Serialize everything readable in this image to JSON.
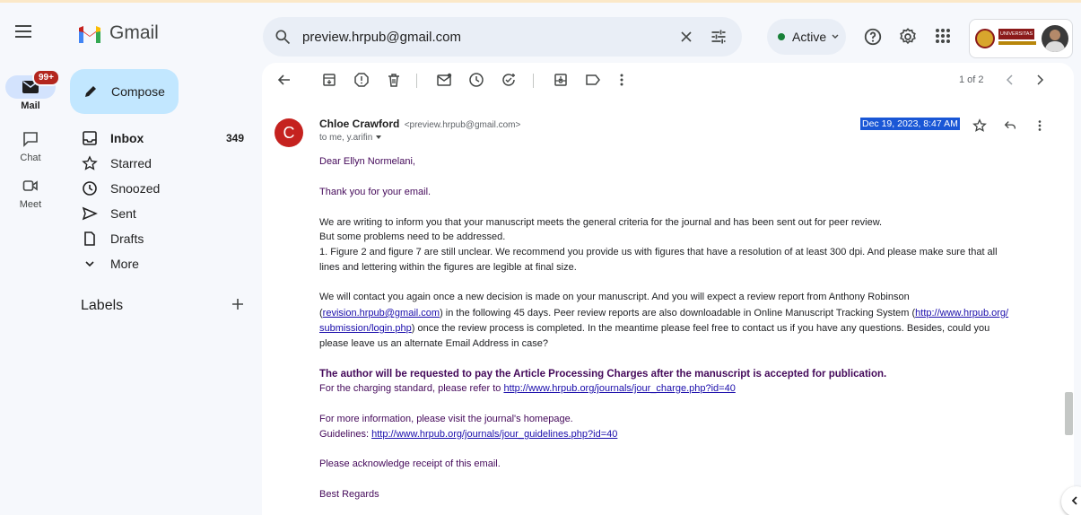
{
  "app": {
    "name": "Gmail"
  },
  "search": {
    "query": "preview.hrpub@gmail.com"
  },
  "status": {
    "label": "Active",
    "color": "#188038"
  },
  "rail": {
    "mail": {
      "label": "Mail",
      "badge": "99+"
    },
    "chat": {
      "label": "Chat"
    },
    "meet": {
      "label": "Meet"
    }
  },
  "nav": {
    "compose_label": "Compose",
    "items": [
      {
        "label": "Inbox",
        "count": "349",
        "icon": "inbox-icon"
      },
      {
        "label": "Starred",
        "count": "",
        "icon": "star-icon"
      },
      {
        "label": "Snoozed",
        "count": "",
        "icon": "clock-icon"
      },
      {
        "label": "Sent",
        "count": "",
        "icon": "send-icon"
      },
      {
        "label": "Drafts",
        "count": "",
        "icon": "draft-icon"
      },
      {
        "label": "More",
        "count": "",
        "icon": "chevron-down-icon"
      }
    ],
    "labels_heading": "Labels"
  },
  "toolbar": {
    "pager": "1 of 2",
    "icons": [
      "back-arrow-icon",
      "archive-icon",
      "report-spam-icon",
      "delete-icon",
      "mark-unread-icon",
      "snooze-icon",
      "add-task-icon",
      "move-to-icon",
      "label-icon",
      "more-vert-icon"
    ]
  },
  "message": {
    "sender_initial": "C",
    "sender_name": "Chloe Crawford",
    "sender_email": "<preview.hrpub@gmail.com>",
    "to_line": "to me, y.arifin",
    "date": "Dec 19, 2023, 8:47 AM",
    "avatar_color": "#c5221f",
    "body": {
      "greeting": "Dear Ellyn Normelani,",
      "thanks": "Thank you for your email.",
      "p1_line1": "We are writing to inform you that your manuscript meets the general criteria for the journal and has been sent out for peer review.",
      "p1_line2": "But some problems need to be addressed.",
      "p1_line3": "1. Figure 2 and figure 7 are still unclear. We recommend you provide us with figures that have a resolution of at least 300 dpi. And please make sure that all",
      "p1_line4": "lines and lettering within the figures are legible at final size.",
      "p2_line1": "We will contact you again once a new decision is made on your manuscript. And you will expect a review report from Anthony Robinson",
      "p2_l2_open": "(",
      "p2_l2_link1": "revision.hrpub@gmail.com",
      "p2_l2_mid": ") in the following 45 days. Peer review reports are also downloadable in Online Manuscript Tracking System (",
      "p2_l2_link2": "http://www.hrpub.org/",
      "p2_l3_link": "submission/login.php",
      "p2_l3_rest": ") once the review process is completed. In the meantime please feel free to contact us if you have any questions. Besides, could you",
      "p2_line4": "please leave us an alternate Email Address in case?",
      "charges_bold": "The author will be requested to pay the Article Processing Charges after the manuscript is accepted for publication.",
      "charges_text": "For the charging standard, please refer to ",
      "charges_link": "http://www.hrpub.org/journals/jour_charge.php?id=40",
      "info_line": "For more information, please visit the journal's homepage.",
      "guidelines_label": "Guidelines: ",
      "guidelines_link": "http://www.hrpub.org/journals/jour_guidelines.php?id=40",
      "ack": "Please acknowledge receipt of this email.",
      "regards": "Best Regards"
    }
  },
  "org_badge": {
    "name": "UNIVERSITAS"
  }
}
